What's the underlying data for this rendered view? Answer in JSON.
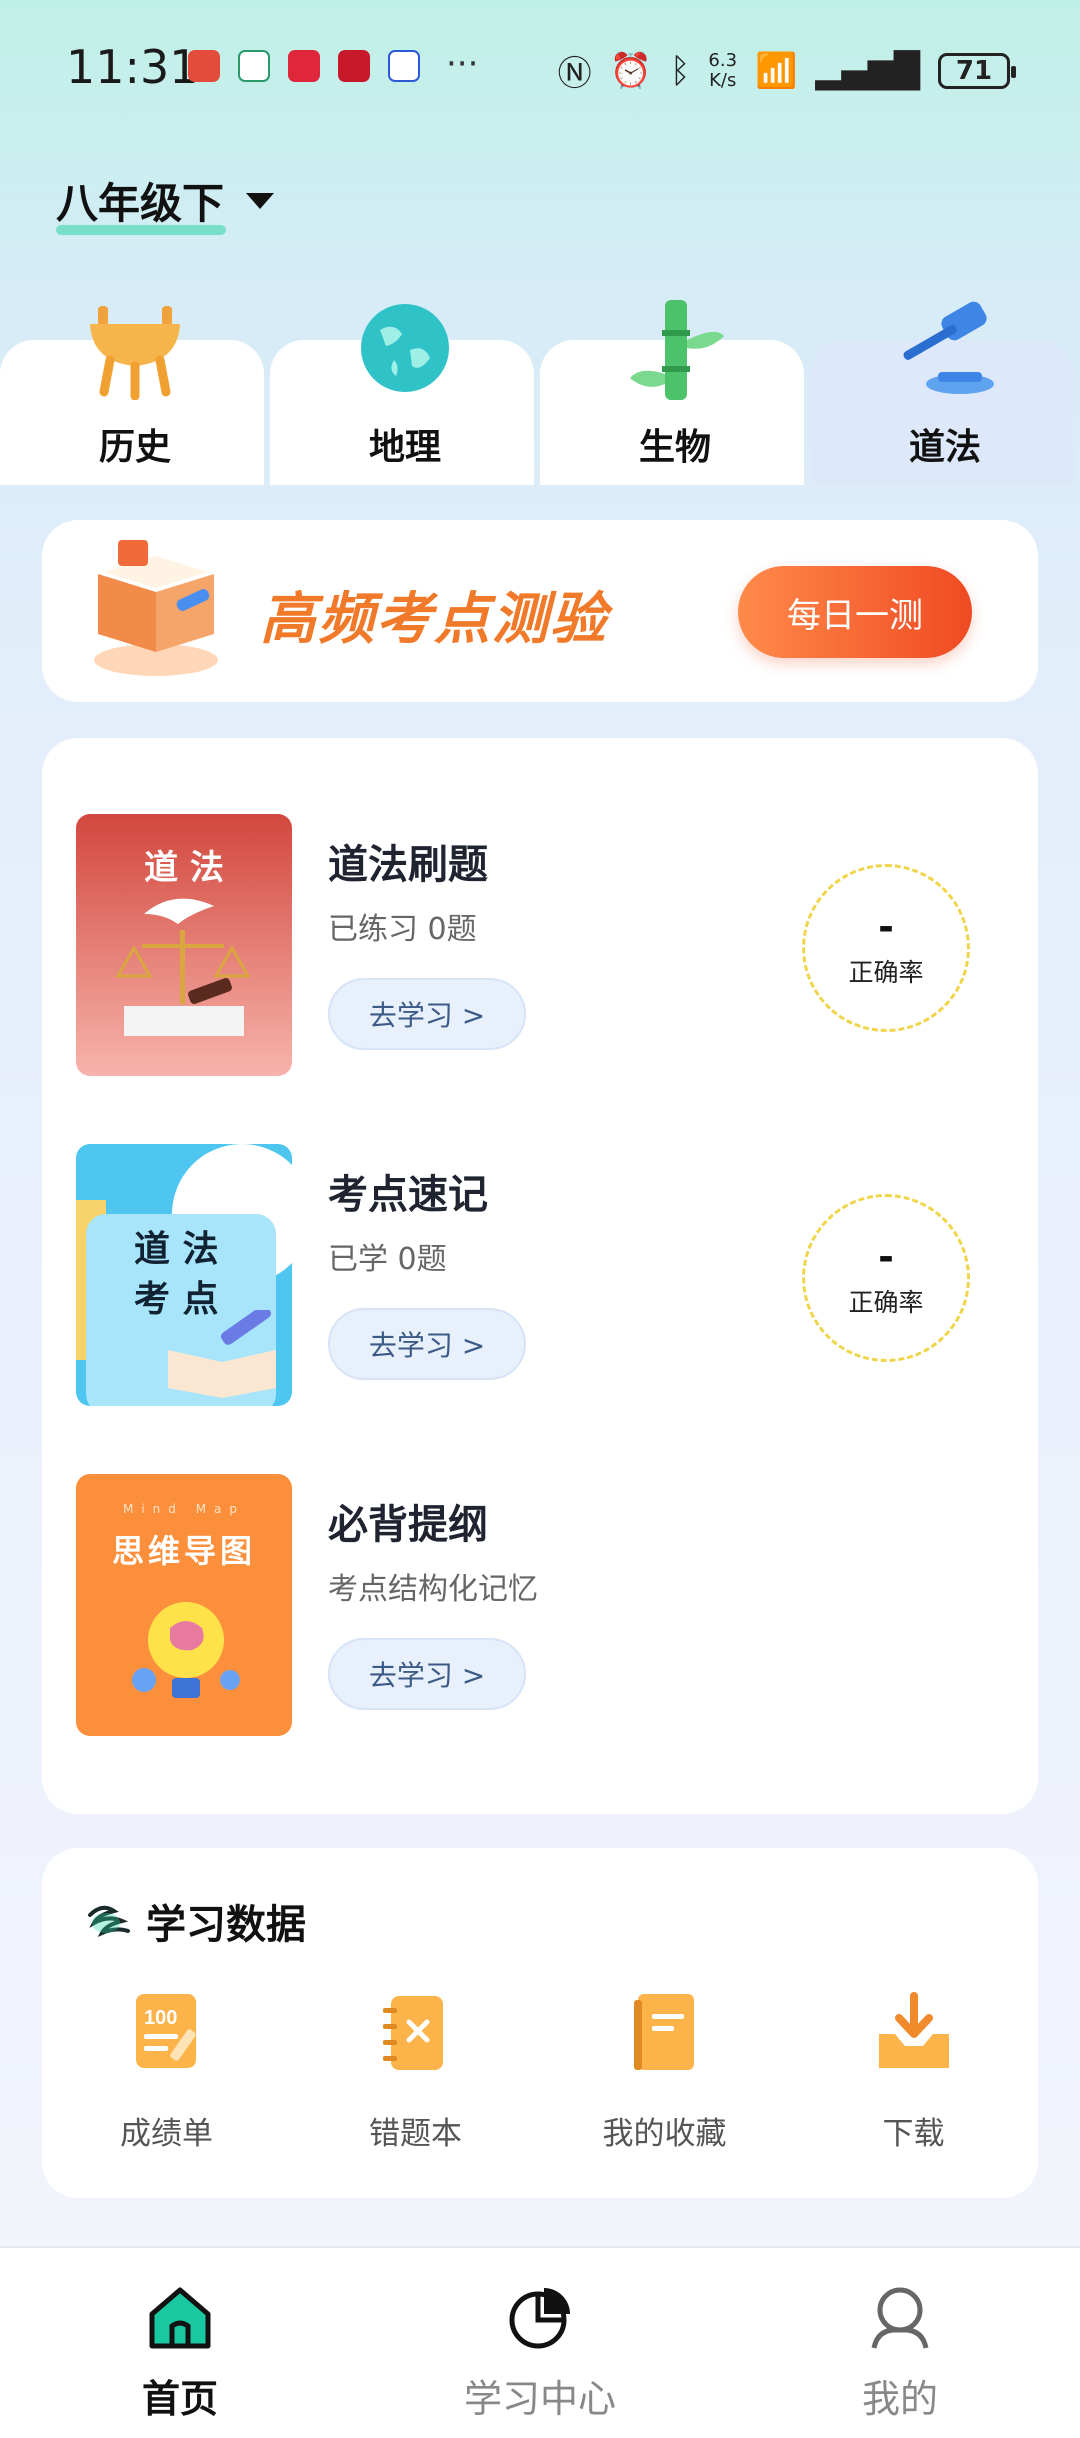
{
  "status": {
    "time": "11:31",
    "battery": "71",
    "net_speed": "6.3\nK/s"
  },
  "grade": {
    "label": "八年级下"
  },
  "subjects": [
    {
      "label": "历史",
      "icon": "ding-vessel-icon"
    },
    {
      "label": "地理",
      "icon": "globe-icon"
    },
    {
      "label": "生物",
      "icon": "bamboo-icon"
    },
    {
      "label": "道法",
      "icon": "gavel-icon",
      "active": true
    }
  ],
  "banner": {
    "title": "高频考点测验",
    "button": "每日一测"
  },
  "courses": [
    {
      "name": "道法刷题",
      "sub": "已练习 0题",
      "go": "去学习 >",
      "rate_value": "-",
      "rate_label": "正确率",
      "cover_text": "道 法"
    },
    {
      "name": "考点速记",
      "sub": "已学 0题",
      "go": "去学习 >",
      "rate_value": "-",
      "rate_label": "正确率",
      "cover_text1": "道 法",
      "cover_text2": "考 点"
    },
    {
      "name": "必背提纲",
      "sub": "考点结构化记忆",
      "go": "去学习 >",
      "cover_small": "Mind Map",
      "cover_text": "思维导图"
    }
  ],
  "stats": {
    "title": "学习数据",
    "items": [
      {
        "label": "成绩单",
        "icon": "score-report-icon"
      },
      {
        "label": "错题本",
        "icon": "wrong-notebook-icon"
      },
      {
        "label": "我的收藏",
        "icon": "favorites-book-icon"
      },
      {
        "label": "下载",
        "icon": "download-icon"
      }
    ]
  },
  "nav": [
    {
      "label": "首页",
      "icon": "home-icon",
      "active": true
    },
    {
      "label": "学习中心",
      "icon": "pie-chart-icon"
    },
    {
      "label": "我的",
      "icon": "user-icon"
    }
  ],
  "colors": {
    "accent": "#f04a23",
    "banner_title": "#f07a2a",
    "go_button_bg": "#e8f0fc",
    "active_tab_bg": "#dde9fb"
  }
}
